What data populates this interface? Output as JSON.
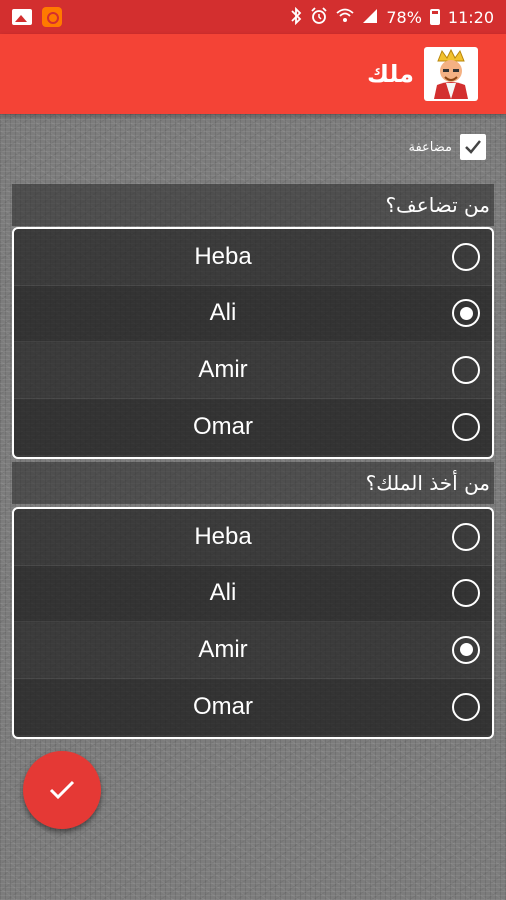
{
  "status_bar": {
    "battery": "78%",
    "time": "11:20"
  },
  "app_bar": {
    "title": "ملك",
    "avatar_icon": "king-avatar-icon"
  },
  "double": {
    "label": "مضاعفة",
    "checked": true
  },
  "questions": [
    {
      "title": "من تضاعف؟",
      "selected": "Ali",
      "options": [
        "Heba",
        "Ali",
        "Amir",
        "Omar"
      ]
    },
    {
      "title": "من أخذ الملك؟",
      "selected": "Amir",
      "options": [
        "Heba",
        "Ali",
        "Amir",
        "Omar"
      ]
    }
  ],
  "fab": {
    "icon": "check-icon"
  },
  "colors": {
    "status_bar": "#d32f2f",
    "app_bar": "#f44336",
    "fab": "#e53935"
  }
}
